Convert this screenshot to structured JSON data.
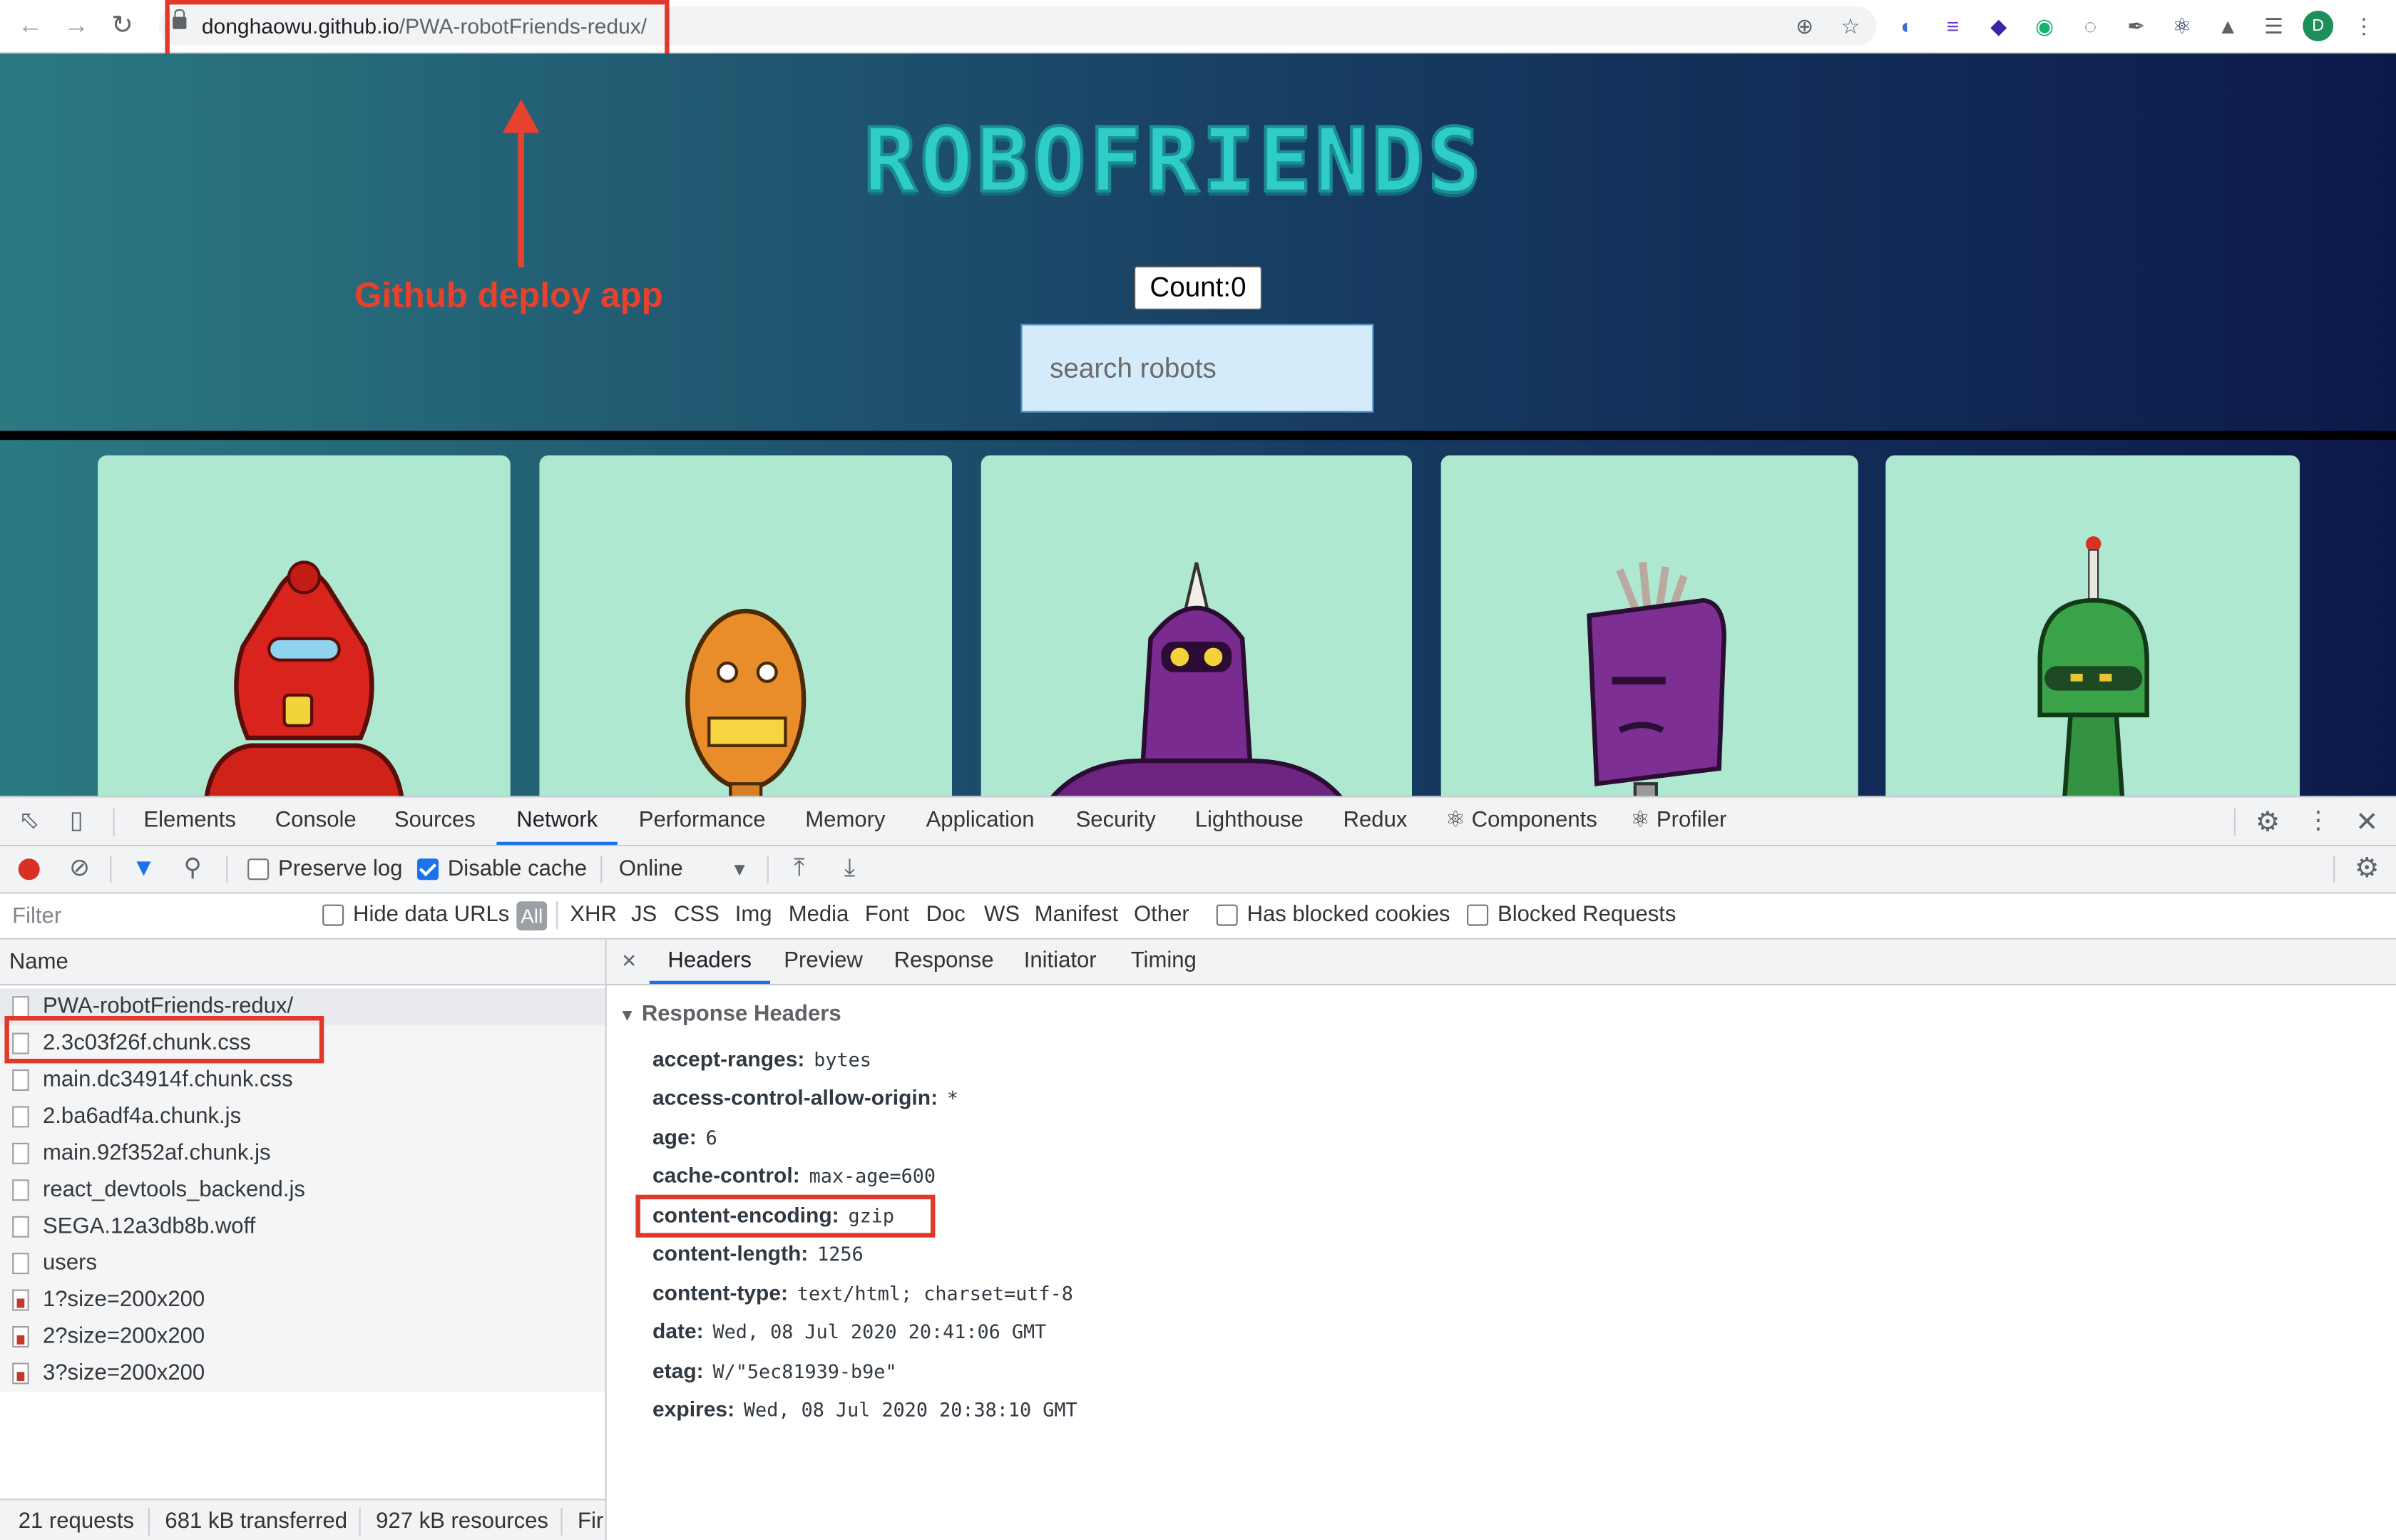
{
  "browser": {
    "url_host": "donghaowu.github.io",
    "url_path": "/PWA-robotFriends-redux/",
    "profile_initial": "D"
  },
  "page": {
    "logo": "ROBOFRIENDS",
    "count_label": "Count:0",
    "search_placeholder": "search robots",
    "annotation": "Github deploy app",
    "robot_colors": [
      "#d8241c",
      "#e98d2b",
      "#7a2b8f",
      "#7d2f94",
      "#3aa34a"
    ]
  },
  "devtools": {
    "tabs": [
      "Elements",
      "Console",
      "Sources",
      "Network",
      "Performance",
      "Memory",
      "Application",
      "Security",
      "Lighthouse",
      "Redux",
      "⚛ Components",
      "⚛ Profiler"
    ],
    "active_tab": "Network",
    "toolbar": {
      "preserve_log": "Preserve log",
      "disable_cache": "Disable cache",
      "throttle": "Online"
    },
    "filter": {
      "placeholder": "Filter",
      "hide_data_urls": "Hide data URLs",
      "all": "All",
      "types": [
        "XHR",
        "JS",
        "CSS",
        "Img",
        "Media",
        "Font",
        "Doc",
        "WS",
        "Manifest",
        "Other"
      ],
      "has_blocked_cookies": "Has blocked cookies",
      "blocked_requests": "Blocked Requests"
    },
    "requests": {
      "column": "Name",
      "rows": [
        "PWA-robotFriends-redux/",
        "2.3c03f26f.chunk.css",
        "main.dc34914f.chunk.css",
        "2.ba6adf4a.chunk.js",
        "main.92f352af.chunk.js",
        "react_devtools_backend.js",
        "SEGA.12a3db8b.woff",
        "users",
        "1?size=200x200",
        "2?size=200x200",
        "3?size=200x200"
      ]
    },
    "status": {
      "requests": "21 requests",
      "transferred": "681 kB transferred",
      "resources": "927 kB resources",
      "finish": "Fir"
    },
    "detail": {
      "close": "×",
      "tabs": [
        "Headers",
        "Preview",
        "Response",
        "Initiator",
        "Timing"
      ],
      "section": "Response Headers",
      "headers": [
        {
          "k": "accept-ranges:",
          "v": "bytes"
        },
        {
          "k": "access-control-allow-origin:",
          "v": "*"
        },
        {
          "k": "age:",
          "v": "6"
        },
        {
          "k": "cache-control:",
          "v": "max-age=600"
        },
        {
          "k": "content-encoding:",
          "v": "gzip"
        },
        {
          "k": "content-length:",
          "v": "1256"
        },
        {
          "k": "content-type:",
          "v": "text/html; charset=utf-8"
        },
        {
          "k": "date:",
          "v": "Wed, 08 Jul 2020 20:41:06 GMT"
        },
        {
          "k": "etag:",
          "v": "W/\"5ec81939-b9e\""
        },
        {
          "k": "expires:",
          "v": "Wed, 08 Jul 2020 20:38:10 GMT"
        }
      ]
    }
  }
}
